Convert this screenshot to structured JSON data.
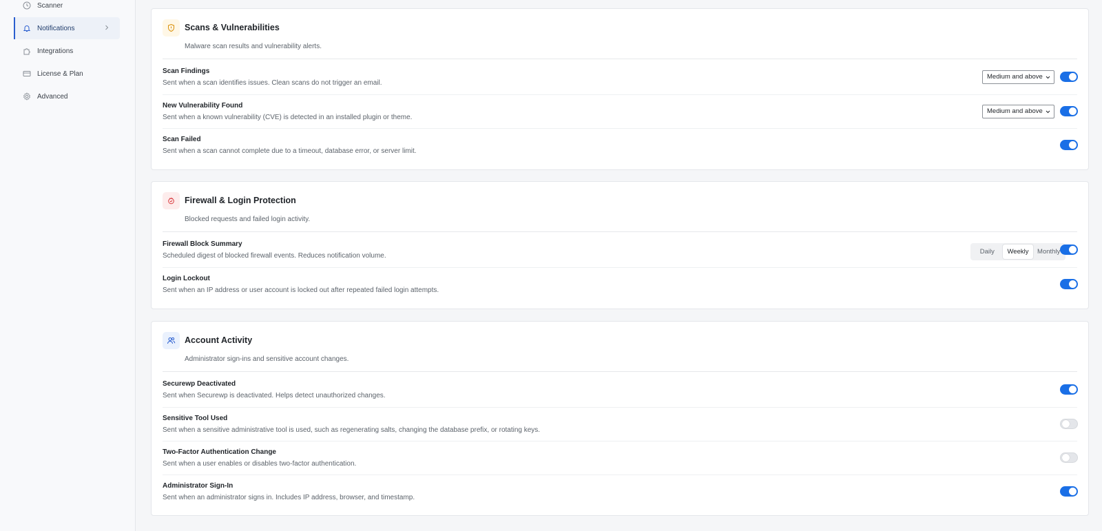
{
  "sidebar": {
    "items": [
      {
        "label": "Scanner",
        "icon": "clock-icon"
      },
      {
        "label": "Notifications",
        "icon": "bell-icon",
        "active": true
      },
      {
        "label": "Integrations",
        "icon": "puzzle-icon"
      },
      {
        "label": "License & Plan",
        "icon": "card-icon"
      },
      {
        "label": "Advanced",
        "icon": "gear-icon"
      }
    ]
  },
  "sections": {
    "scans": {
      "title": "Scans & Vulnerabilities",
      "subtitle": "Malware scan results and vulnerability alerts.",
      "icon": "shield-icon",
      "accent": "#f5a623",
      "rows": [
        {
          "title": "Scan Findings",
          "desc": "Sent when a scan identifies issues. Clean scans do not trigger an email.",
          "select": "Medium and above",
          "enabled": true
        },
        {
          "title": "New Vulnerability Found",
          "desc": "Sent when a known vulnerability (CVE) is detected in an installed plugin or theme.",
          "select": "Medium and above",
          "enabled": true
        },
        {
          "title": "Scan Failed",
          "desc": "Sent when a scan cannot complete due to a timeout, database error, or server limit.",
          "enabled": true
        }
      ]
    },
    "firewall": {
      "title": "Firewall & Login Protection",
      "subtitle": "Blocked requests and failed login activity.",
      "icon": "fire-shield-icon",
      "accent": "#e5484d",
      "rows": [
        {
          "title": "Firewall Block Summary",
          "desc": "Scheduled digest of blocked firewall events. Reduces notification volume.",
          "options": [
            "Daily",
            "Weekly",
            "Monthly"
          ],
          "selected": "Weekly",
          "enabled": true
        },
        {
          "title": "Login Lockout",
          "desc": "Sent when an IP address or user account is locked out after repeated failed login attempts.",
          "enabled": true
        }
      ]
    },
    "account": {
      "title": "Account Activity",
      "subtitle": "Administrator sign-ins and sensitive account changes.",
      "icon": "users-icon",
      "accent": "#2a5ecf",
      "rows": [
        {
          "title": "Securewp Deactivated",
          "desc": "Sent when Securewp is deactivated. Helps detect unauthorized changes.",
          "enabled": true
        },
        {
          "title": "Sensitive Tool Used",
          "desc": "Sent when a sensitive administrative tool is used, such as regenerating salts, changing the database prefix, or rotating keys.",
          "enabled": false
        },
        {
          "title": "Two-Factor Authentication Change",
          "desc": "Sent when a user enables or disables two-factor authentication.",
          "enabled": false
        },
        {
          "title": "Administrator Sign-In",
          "desc": "Sent when an administrator signs in. Includes IP address, browser, and timestamp.",
          "enabled": true
        }
      ]
    }
  },
  "colors": {
    "toggle_on": "#1a6fe6",
    "toggle_off": "#e4e6ea",
    "nav_active_bar": "#2a5ecf"
  }
}
